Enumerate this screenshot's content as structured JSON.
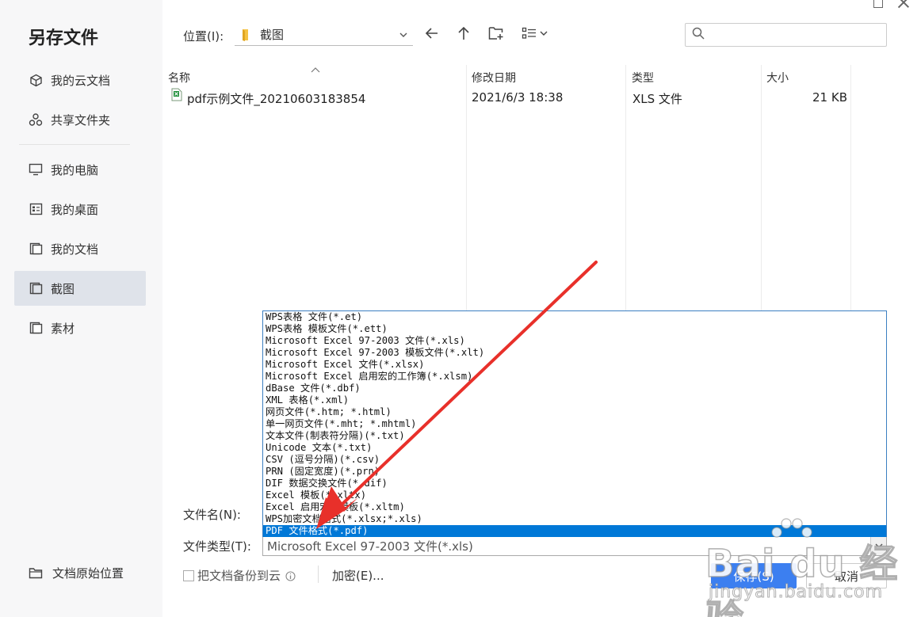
{
  "dialog": {
    "title": "另存文件"
  },
  "sidebar": {
    "items": [
      {
        "label": "我的云文档",
        "icon": "cloud-doc-icon"
      },
      {
        "label": "共享文件夹",
        "icon": "share-folder-icon"
      },
      {
        "label": "我的电脑",
        "icon": "computer-icon"
      },
      {
        "label": "我的桌面",
        "icon": "desktop-icon"
      },
      {
        "label": "我的文档",
        "icon": "documents-icon"
      },
      {
        "label": "截图",
        "icon": "folder-icon",
        "active": true
      },
      {
        "label": "素材",
        "icon": "folder-icon"
      }
    ],
    "original_location": "文档原始位置"
  },
  "toolbar": {
    "location_label": "位置(I):",
    "location_value": "截图",
    "search_placeholder": ""
  },
  "file_list": {
    "columns": [
      "名称",
      "修改日期",
      "类型",
      "大小"
    ],
    "rows": [
      {
        "name": "pdf示例文件_20210603183854",
        "modified": "2021/6/3 18:38",
        "type": "XLS 文件",
        "size": "21 KB"
      }
    ]
  },
  "form": {
    "filename_label": "文件名(N):",
    "filetype_label": "文件类型(T):",
    "filetype_value": "Microsoft Excel 97-2003 文件(*.xls)",
    "backup_label": "把文档备份到云",
    "encrypt_label": "加密(E)...",
    "save_label": "保存(S)",
    "cancel_label": "取消"
  },
  "filetype_options": [
    "WPS表格 文件(*.et)",
    "WPS表格 模板文件(*.ett)",
    "Microsoft Excel 97-2003 文件(*.xls)",
    "Microsoft Excel 97-2003 模板文件(*.xlt)",
    "Microsoft Excel 文件(*.xlsx)",
    "Microsoft Excel 启用宏的工作簿(*.xlsm)",
    "dBase 文件(*.dbf)",
    "XML 表格(*.xml)",
    "网页文件(*.htm; *.html)",
    "单一网页文件(*.mht; *.mhtml)",
    "文本文件(制表符分隔)(*.txt)",
    "Unicode 文本(*.txt)",
    "CSV (逗号分隔)(*.csv)",
    "PRN (固定宽度)(*.prn)",
    "DIF 数据交换文件(*.dif)",
    "Excel 模板(*.xltx)",
    "Excel 启用宏的模板(*.xltm)",
    "WPS加密文档格式(*.xlsx;*.xls)",
    "PDF 文件格式(*.pdf)"
  ],
  "selected_option_index": 18,
  "watermark": {
    "logo": "Bai du 经验",
    "sub": "jingyan.baidu.com"
  },
  "colors": {
    "accent": "#3c7ff0",
    "selection": "#0078d7",
    "annotation_arrow": "#e8302a"
  }
}
